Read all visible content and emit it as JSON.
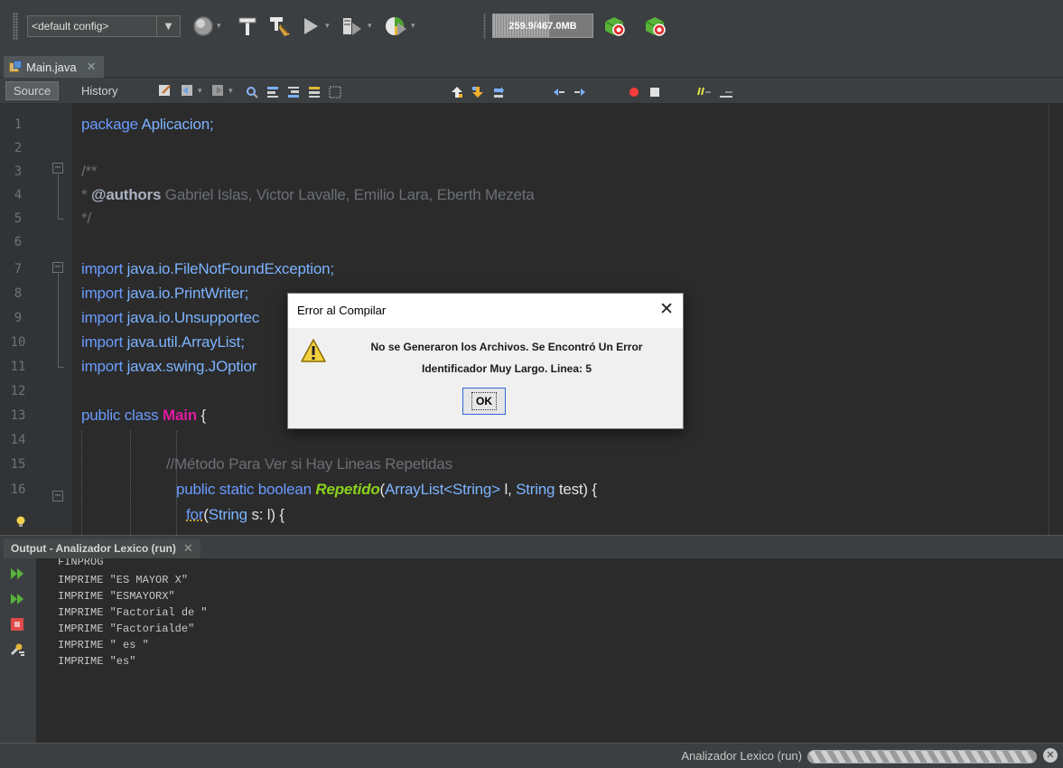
{
  "toolbar": {
    "config_value": "<default config>",
    "memory": {
      "used": "259.9",
      "total": "467.0MB",
      "label": "259.9/467.0MB",
      "fraction": 0.56
    }
  },
  "editor": {
    "tab_label": "Main.java",
    "source_label": "Source",
    "history_label": "History",
    "line_numbers": [
      "1",
      "2",
      "3",
      "4",
      "5",
      "6",
      "7",
      "8",
      "9",
      "10",
      "11",
      "12",
      "13",
      "14",
      "15",
      "16"
    ],
    "lines": {
      "l1": {
        "kw": "package",
        "rest": " Aplicacion;"
      },
      "l3": "/**",
      "l4_prefix": "* ",
      "l4_tag": "@authors",
      "l4_rest": " Gabriel Islas, Victor Lavalle, Emilio Lara, Eberth Mezeta",
      "l5": "*/",
      "l7": {
        "kw": "import",
        "rest": " java.io.FileNotFoundException;"
      },
      "l8": {
        "kw": "import",
        "rest": " java.io.PrintWriter;"
      },
      "l9": {
        "kw": "import",
        "rest": " java.io.Unsupportec"
      },
      "l10": {
        "kw": "import",
        "rest": " java.util.ArrayList;"
      },
      "l11": {
        "kw": "import",
        "rest": " javax.swing.JOptior"
      },
      "l13": {
        "kw": "public class",
        "cls": "Main",
        "rest": " {"
      },
      "l15": "//Método Para Ver si Hay Lineas Repetidas",
      "l16": {
        "kw": "public static boolean",
        "method": "Repetido",
        "open": "(",
        "type1": "ArrayList<String>",
        "p1": " l, ",
        "type2": "String",
        "p2": " test) {"
      },
      "l17": {
        "kw": "for",
        "open": "(",
        "type": "String",
        "rest": " s: l) {"
      }
    }
  },
  "output": {
    "tab_label": "Output - Analizador Lexico (run)",
    "lines": [
      "FINPROG",
      "IMPRIME \"ES MAYOR X\"",
      "IMPRIME \"ESMAYORX\"",
      "IMPRIME \"Factorial de \"",
      "IMPRIME \"Factorialde\"",
      "IMPRIME \" es \"",
      "IMPRIME \"es\""
    ]
  },
  "status": {
    "task_label": "Analizador Lexico (run)",
    "progress_fraction": 1.0
  },
  "dialog": {
    "title": "Error al Compilar",
    "message_line1": "No se Generaron los Archivos. Se Encontró Un Error",
    "message_line2": "Identificador Muy Largo.  Linea: 5",
    "ok_label": "OK"
  },
  "colors": {
    "keyword": "#6a9bff",
    "class_name": "#e01ba0",
    "method_name": "#8bd11a",
    "comment": "#6b6f76",
    "background": "#2b2b2b",
    "panel": "#3c3f41"
  },
  "icons": [
    "globe-icon",
    "hammer-icon",
    "clean-build-icon",
    "run-icon",
    "debug-icon",
    "profile-icon",
    "gc-icon",
    "gc-all-icon",
    "warning-icon",
    "bulb-icon"
  ]
}
